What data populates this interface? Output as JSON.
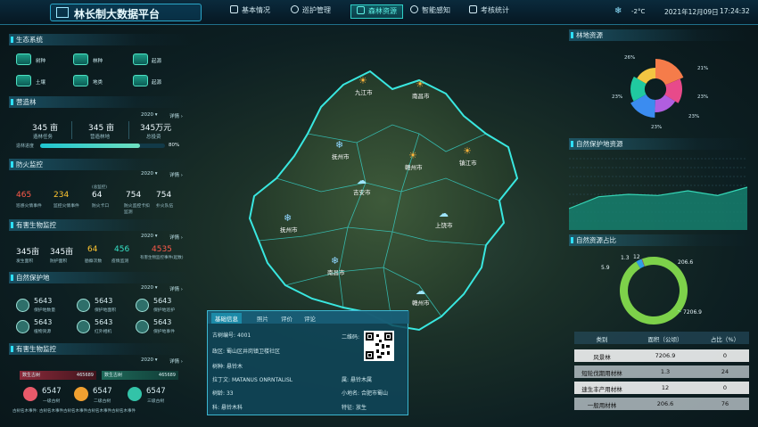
{
  "header": {
    "title": "林长制大数据平台",
    "temperature": "-2°C",
    "date": "2021年12月09日",
    "time": "17:24:32"
  },
  "nav": [
    {
      "label": "基本情况"
    },
    {
      "label": "巡护管理"
    },
    {
      "label": "森林资源"
    },
    {
      "label": "智能感知"
    },
    {
      "label": "考核统计"
    }
  ],
  "ecology": {
    "title": "生态系统",
    "items": [
      {
        "label": "树种"
      },
      {
        "label": "林种"
      },
      {
        "label": "起源"
      },
      {
        "label": "土壤"
      },
      {
        "label": "地类"
      },
      {
        "label": "起源"
      }
    ]
  },
  "afforest": {
    "title": "营造林",
    "year": "2020",
    "detail": "详情",
    "stats": [
      {
        "value": "345 亩",
        "label": "造林任务"
      },
      {
        "value": "345 亩",
        "label": "营造林地"
      },
      {
        "value": "345万元",
        "label": "总投资"
      }
    ],
    "progress_label": "造林进度",
    "progress_pct": "80%",
    "progress": 0.8
  },
  "fire": {
    "title": "防火监控",
    "year": "2020",
    "detail": "详情",
    "stats": [
      {
        "value": "465",
        "label": "巡感火情事件",
        "color": "#ff5a4a"
      },
      {
        "value": "234",
        "label": "监控火情事件",
        "color": "#ffc531"
      },
      {
        "value": "64",
        "label": "防火卡口",
        "sub": "(总监控)",
        "color": "#e8f6fa"
      },
      {
        "value": "754",
        "label": "防火监控卡扣监测",
        "color": "#e8f6fa"
      },
      {
        "value": "754",
        "label": "扑火队伍",
        "color": "#e8f6fa"
      }
    ]
  },
  "pest": {
    "title": "有害生物监控",
    "year": "2020",
    "detail": "详情",
    "stats": [
      {
        "value": "345亩",
        "label": "发生面积",
        "color": "#e8f6fa"
      },
      {
        "value": "345亩",
        "label": "防护面积",
        "color": "#e8f6fa"
      },
      {
        "value": "64",
        "label": "勘察次数",
        "color": "#ffc531"
      },
      {
        "value": "456",
        "label": "疫情监测",
        "color": "#36e3c7"
      },
      {
        "value": "4535",
        "label": "有害生物监控事件(起数)",
        "color": "#ff5a4a"
      }
    ]
  },
  "reserve": {
    "title": "自然保护地",
    "year": "2020",
    "detail": "详情",
    "stats": [
      {
        "value": "5643",
        "label": "保护地数量"
      },
      {
        "value": "5643",
        "label": "保护地面积"
      },
      {
        "value": "5643",
        "label": "保护地巡护"
      },
      {
        "value": "5643",
        "label": "植物资源"
      },
      {
        "value": "5643",
        "label": "红外相机"
      },
      {
        "value": "5643",
        "label": "保护地事件"
      }
    ]
  },
  "pest2": {
    "title": "有害生物监控",
    "year": "2020",
    "detail": "详情",
    "tag1": "数生古树",
    "tag1_val": "465689",
    "tag2": "数生古树",
    "tag2_val": "465689",
    "circles": [
      {
        "value": "6547",
        "label": "一级古树",
        "color": "#e85a6a"
      },
      {
        "value": "6547",
        "label": "二级古树",
        "color": "#f0a030"
      },
      {
        "value": "6547",
        "label": "三级古树",
        "color": "#33c3a8"
      }
    ],
    "footer": "古树名木事件: 古树名木事件古树名木事件古树名木事件古树名木事件"
  },
  "map": {
    "cities": [
      {
        "name": "九江市",
        "weather": "sun"
      },
      {
        "name": "南昌市",
        "weather": "sun"
      },
      {
        "name": "抚州市",
        "weather": "snow"
      },
      {
        "name": "赣州市",
        "weather": "sun"
      },
      {
        "name": "镇江市",
        "weather": "sun"
      },
      {
        "name": "吉安市",
        "weather": "rain"
      },
      {
        "name": "抚州市",
        "weather": "snow"
      },
      {
        "name": "上饶市",
        "weather": "rain"
      },
      {
        "name": "南昌市",
        "weather": "snow"
      },
      {
        "name": "赣州市",
        "weather": "rain"
      }
    ]
  },
  "info": {
    "tabs": [
      "基础信息",
      "照片",
      "评价",
      "评论"
    ],
    "rows": [
      {
        "label": "古树编号:",
        "value": "4001"
      },
      {
        "label": "政区:",
        "value": "蜀山区井岗镇卫楼社区"
      },
      {
        "label": "树种:",
        "value": "悬铃木"
      },
      {
        "label": "拉丁文:",
        "value": "MATANUS ONRNTALISL"
      },
      {
        "label": "树龄:",
        "value": "33"
      },
      {
        "label": "科:",
        "value": "悬铃木科"
      }
    ],
    "qr_label": "二维码:",
    "genus_label": "属:",
    "genus": "悬铃木属",
    "place_label": "小地名:",
    "place": "合肥市蜀山",
    "feature_label": "特征:",
    "feature": "放生"
  },
  "forest": {
    "title": "林地资源"
  },
  "reserve_res": {
    "title": "自然保护地资源"
  },
  "natural": {
    "title": "自然资源占比"
  },
  "chart_data": [
    {
      "type": "pie",
      "title": "林地资源",
      "labels": [
        "26%",
        "21%",
        "23%",
        "23%",
        "23%",
        "23%"
      ],
      "values": [
        26,
        21,
        23,
        23,
        23,
        23
      ],
      "colors": [
        "#f57c4a",
        "#e84a8a",
        "#b05ee0",
        "#3b8cf0",
        "#20c9a0",
        "#f2c542"
      ]
    },
    {
      "type": "area",
      "title": "自然保护地资源",
      "x": [
        1,
        2,
        3,
        4,
        5,
        6,
        7
      ],
      "values": [
        18,
        28,
        30,
        29,
        33,
        29,
        36
      ],
      "ylim": [
        0,
        60
      ]
    },
    {
      "type": "pie",
      "title": "自然资源占比",
      "values": [
        7206.9,
        206.6,
        12,
        1.3,
        5.9
      ],
      "labels": [
        "7206.9",
        "206.6",
        "12",
        "1.3",
        "5.9"
      ],
      "colors": [
        "#7dd14a",
        "#2f9ee8",
        "#e84a4a",
        "#f2c542",
        "#9b6ad8"
      ]
    },
    {
      "type": "table",
      "columns": [
        "类别",
        "面积（公顷）",
        "占比（%）"
      ],
      "rows": [
        [
          "风景林",
          "7206.9",
          "0"
        ],
        [
          "短轮伐期用材林",
          "1.3",
          "24"
        ],
        [
          "速生丰产用材林",
          "12",
          "0"
        ],
        [
          "一般用材林",
          "206.6",
          "76"
        ]
      ]
    }
  ]
}
